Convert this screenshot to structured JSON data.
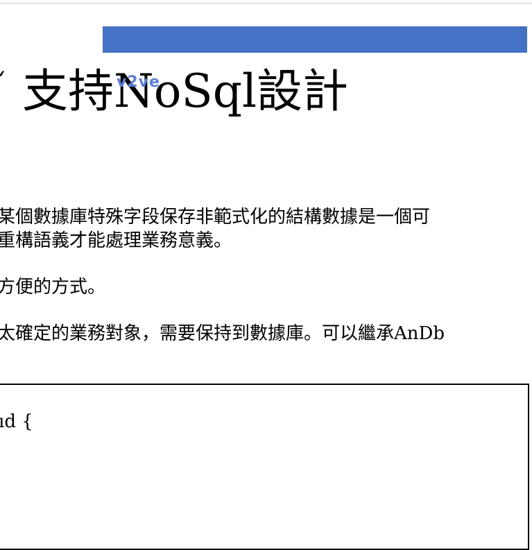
{
  "slide": {
    "title_glyph": "ˇ",
    "title": "支持NoSql設計",
    "overlay_label": "v2ve"
  },
  "paragraphs": [
    "某個數據庫特殊字段保存非範式化的結構數據是一個可",
    "重構語義才能處理業務意義。",
    "方便的方式。",
    "太確定的業務對象，需要保持到數據庫。可以繼承AnDb"
  ],
  "code": {
    "line1": "ıd {"
  }
}
